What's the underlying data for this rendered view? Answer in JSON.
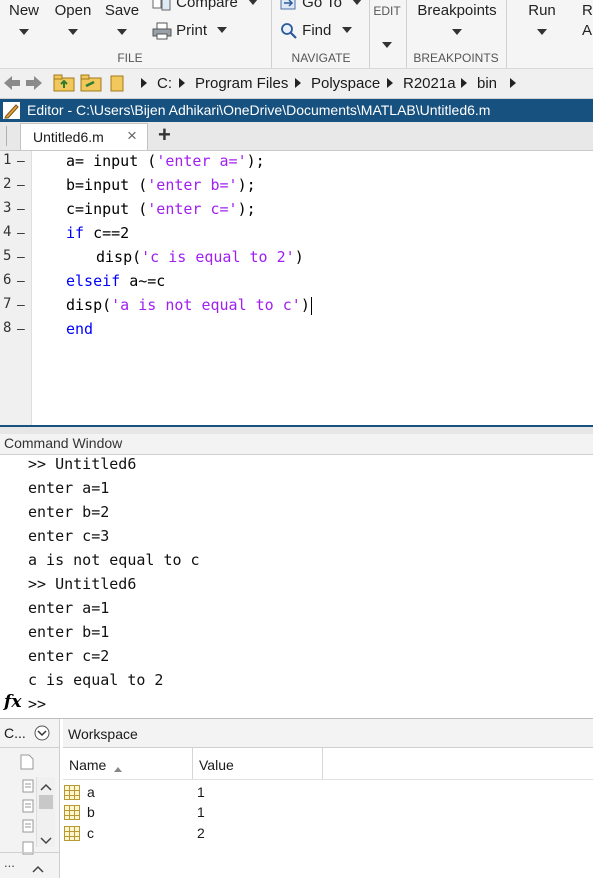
{
  "toolstrip": {
    "new_label": "New",
    "open_label": "Open",
    "save_label": "Save",
    "compare_label": "Compare",
    "print_label": "Print",
    "goto_label": "Go To",
    "find_label": "Find",
    "edit_label": "EDIT",
    "breakpoints_label": "Breakpoints",
    "run_label": "Run",
    "run_partial_1": "R",
    "run_partial_2": "A",
    "sections": {
      "file": "FILE",
      "navigate": "NAVIGATE",
      "breakpoints": "BREAKPOINTS"
    }
  },
  "address": {
    "crumbs": [
      "C:",
      "Program Files",
      "Polyspace",
      "R2021a",
      "bin"
    ]
  },
  "editor": {
    "title": "Editor - C:\\Users\\Bijen Adhikari\\OneDrive\\Documents\\MATLAB\\Untitled6.m",
    "tab_label": "Untitled6.m",
    "tab_close": "×",
    "add_tab": "+",
    "line_numbers": [
      "1",
      "2",
      "3",
      "4",
      "5",
      "6",
      "7",
      "8"
    ],
    "lines": [
      {
        "plain": "a= input (",
        "str": "'enter a='",
        "tail": ");"
      },
      {
        "plain": "b=input (",
        "str": "'enter b='",
        "tail": ");"
      },
      {
        "plain": "c=input (",
        "str": "'enter c='",
        "tail": ");"
      },
      {
        "kw": "if",
        "rest": " c==2"
      },
      {
        "plain": "disp(",
        "str": "'c is equal to 2'",
        "tail": ")"
      },
      {
        "kw": "elseif",
        "rest": " a~=c"
      },
      {
        "plain": "disp(",
        "str": "'a is not equal to c'",
        "tail": ")"
      },
      {
        "kw": "end"
      }
    ]
  },
  "command_window": {
    "title": "Command Window",
    "lines": [
      ">> Untitled6",
      "enter a=1",
      "enter b=2",
      "enter c=3",
      "a is not equal to c",
      ">> Untitled6",
      "enter a=1",
      "enter b=1",
      "enter c=2",
      "c is equal to 2"
    ],
    "fx": "fx",
    "prompt": ">>"
  },
  "left_panel": {
    "title": "C..."
  },
  "workspace": {
    "title": "Workspace",
    "columns": {
      "name": "Name",
      "value": "Value"
    },
    "rows": [
      {
        "name": "a",
        "value": "1"
      },
      {
        "name": "b",
        "value": "1"
      },
      {
        "name": "c",
        "value": "2"
      }
    ]
  },
  "colors": {
    "title_bar": "#17517f",
    "keyword": "#0000ff",
    "string": "#a020f0"
  }
}
